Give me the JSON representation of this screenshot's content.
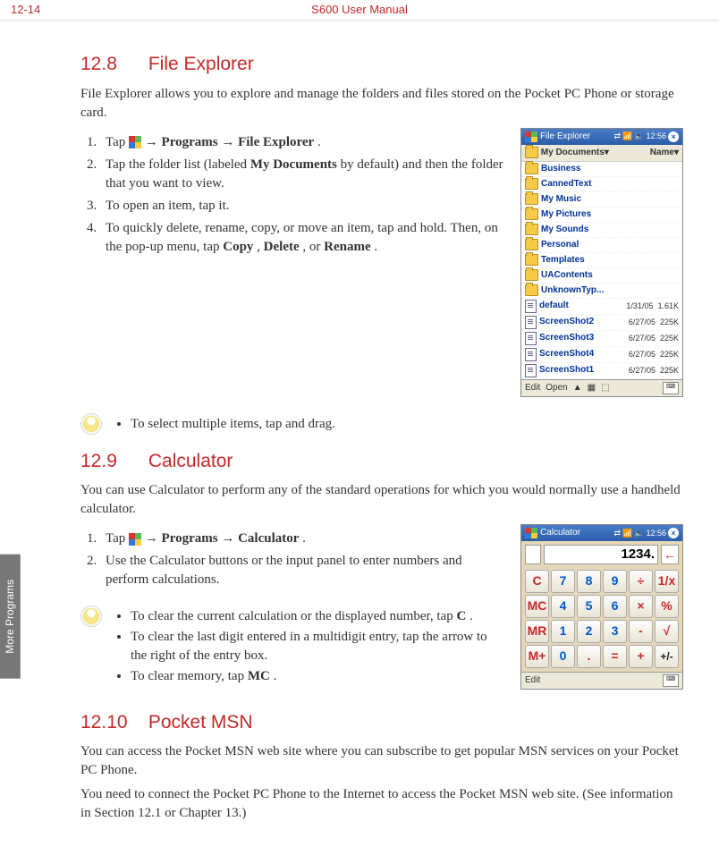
{
  "header": {
    "page": "12-14",
    "manual": "S600 User Manual"
  },
  "sidetab": "More Programs",
  "sec1": {
    "num": "12.8",
    "title": "File Explorer",
    "intro": "File Explorer allows you to explore and manage the folders and files stored on the Pocket PC Phone or storage card.",
    "steps": {
      "s1a": "Tap ",
      "s1b": " → ",
      "s1c": "Programs",
      "s1d": " → ",
      "s1e": "File Explorer",
      "s1f": ".",
      "s2a": "Tap the folder list (labeled ",
      "s2b": "My Documents",
      "s2c": " by default) and then the folder that you want to view.",
      "s3": "To open an item, tap it.",
      "s4a": "To quickly delete, rename, copy, or move an item, tap and hold. Then, on the pop-up menu, tap ",
      "s4b": "Copy",
      "s4c": ", ",
      "s4d": "Delete",
      "s4e": ", or ",
      "s4f": "Rename",
      "s4g": "."
    },
    "tip": "To select multiple items, tap and drag.",
    "screenshot": {
      "title": "File Explorer",
      "time": "12:56",
      "subbar_left": "My Documents",
      "subbar_right": "Name",
      "folders": [
        "Business",
        "CannedText",
        "My Music",
        "My Pictures",
        "My Sounds",
        "Personal",
        "Templates",
        "UAContents",
        "UnknownTyp..."
      ],
      "files": [
        {
          "name": "default",
          "date": "1/31/05",
          "size": "1.61K"
        },
        {
          "name": "ScreenShot2",
          "date": "6/27/05",
          "size": "225K"
        },
        {
          "name": "ScreenShot3",
          "date": "6/27/05",
          "size": "225K"
        },
        {
          "name": "ScreenShot4",
          "date": "6/27/05",
          "size": "225K"
        },
        {
          "name": "ScreenShot1",
          "date": "6/27/05",
          "size": "225K"
        }
      ],
      "bottom_left": "Edit",
      "bottom_mid": "Open",
      "up": "▲"
    }
  },
  "sec2": {
    "num": "12.9",
    "title": "Calculator",
    "intro": "You can use Calculator to perform any of the standard operations for which you would normally use a handheld calculator.",
    "steps": {
      "s1a": "Tap ",
      "s1b": " → ",
      "s1c": "Programs",
      "s1d": " → ",
      "s1e": "Calculator",
      "s1f": ".",
      "s2": "Use the Calculator buttons or the input panel to enter numbers and perform calculations."
    },
    "tips": {
      "t1a": "To clear the current calculation or the displayed number, tap ",
      "t1b": "C",
      "t1c": ".",
      "t2": "To clear the last digit entered in a multidigit entry, tap the arrow to the right of the entry box.",
      "t3a": "To clear memory, tap ",
      "t3b": "MC",
      "t3c": "."
    },
    "screenshot": {
      "title": "Calculator",
      "time": "12:56",
      "display": "1234.",
      "back": "←",
      "edit": "Edit",
      "buttons": [
        [
          "C",
          "7",
          "8",
          "9",
          "÷",
          "1/x"
        ],
        [
          "MC",
          "4",
          "5",
          "6",
          "×",
          "%"
        ],
        [
          "MR",
          "1",
          "2",
          "3",
          "-",
          "√"
        ],
        [
          "M+",
          "0",
          ".",
          "=",
          "+",
          "+/-"
        ]
      ],
      "colors": [
        [
          "red",
          "blue",
          "blue",
          "blue",
          "red",
          "red"
        ],
        [
          "red",
          "blue",
          "blue",
          "blue",
          "red",
          "red"
        ],
        [
          "red",
          "blue",
          "blue",
          "blue",
          "red",
          "red"
        ],
        [
          "red",
          "blue",
          "red",
          "red",
          "red",
          "black"
        ]
      ]
    }
  },
  "sec3": {
    "num": "12.10",
    "title": "Pocket MSN",
    "p1": "You can access the Pocket MSN web site where you can subscribe to get popular MSN services on your Pocket PC Phone.",
    "p2": "You need to connect the Pocket PC Phone to the Internet to access the Pocket MSN web site. (See information in Section 12.1 or Chapter 13.)"
  }
}
